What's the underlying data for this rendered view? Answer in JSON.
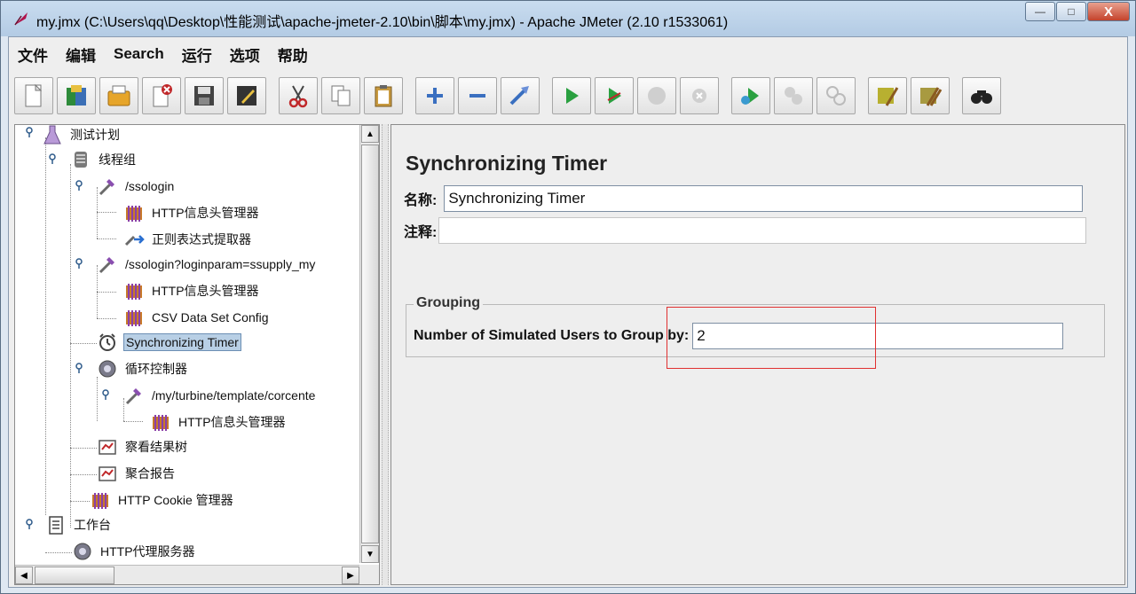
{
  "window": {
    "title": "my.jmx (C:\\Users\\qq\\Desktop\\性能测试\\apache-jmeter-2.10\\bin\\脚本\\my.jmx) - Apache JMeter (2.10 r1533061)",
    "minimize": "—",
    "maximize": "□",
    "close": "X"
  },
  "menu": [
    "文件",
    "编辑",
    "Search",
    "运行",
    "选项",
    "帮助"
  ],
  "toolbar": [
    "new-icon",
    "open-templates-icon",
    "open-icon",
    "close-icon",
    "save-icon",
    "save-as-icon",
    "cut-icon",
    "copy-icon",
    "paste-icon",
    "expand-icon",
    "collapse-icon",
    "toggle-icon",
    "start-icon",
    "start-no-pause-icon",
    "stop-icon",
    "shutdown-icon",
    "remote-start-icon",
    "remote-stop-icon",
    "remote-shutdown-icon",
    "clear-icon",
    "clear-all-icon",
    "search-binoculars-icon"
  ],
  "tree": {
    "nodes": [
      {
        "label": "测试计划"
      },
      {
        "label": "线程组"
      },
      {
        "label": "/ssologin"
      },
      {
        "label": "HTTP信息头管理器"
      },
      {
        "label": "正则表达式提取器"
      },
      {
        "label": "/ssologin?loginparam=ssupply_my"
      },
      {
        "label": "HTTP信息头管理器"
      },
      {
        "label": "CSV Data Set Config"
      },
      {
        "label": "Synchronizing Timer"
      },
      {
        "label": "循环控制器"
      },
      {
        "label": "/my/turbine/template/corcente"
      },
      {
        "label": "HTTP信息头管理器"
      },
      {
        "label": "察看结果树"
      },
      {
        "label": "聚合报告"
      },
      {
        "label": "HTTP Cookie 管理器"
      },
      {
        "label": "工作台"
      },
      {
        "label": "HTTP代理服务器"
      }
    ]
  },
  "editor": {
    "title": "Synchronizing Timer",
    "name_label": "名称:",
    "name_value": "Synchronizing Timer",
    "comment_label": "注释:",
    "comment_value": "",
    "group_title": "Grouping",
    "users_label": "Number of Simulated Users to Group by:",
    "users_value": "2"
  }
}
